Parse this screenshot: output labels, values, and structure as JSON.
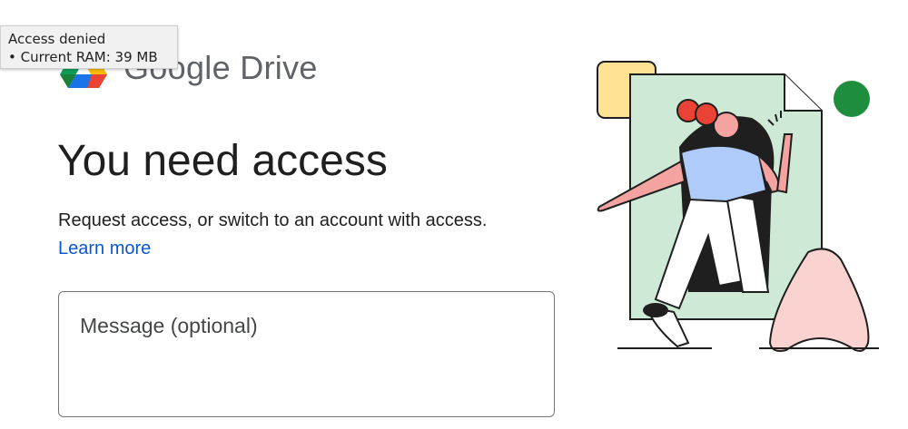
{
  "tooltip": {
    "line1": "Access denied",
    "line2": "• Current RAM: 39 MB"
  },
  "logo": {
    "text": "Google Drive",
    "icon": "google-drive-icon"
  },
  "heading": "You need access",
  "description": "Request access, or switch to an account with access.",
  "learn_more": "Learn more",
  "message": {
    "placeholder": "Message (optional)",
    "value": ""
  },
  "colors": {
    "link": "#0b57d0",
    "illustration_green": "#ceead6",
    "illustration_yellow": "#fde293",
    "illustration_red": "#ea4335",
    "illustration_blue": "#aecbfa",
    "illustration_pink": "#fad2cf",
    "dot_green": "#1e8e3e"
  }
}
